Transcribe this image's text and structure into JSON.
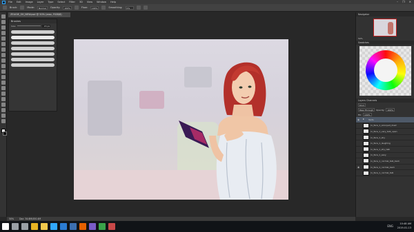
{
  "menubar": {
    "app_logo": "Ps",
    "items": [
      "File",
      "Edit",
      "Image",
      "Layer",
      "Type",
      "Select",
      "Filter",
      "3D",
      "View",
      "Window",
      "Help"
    ],
    "window_controls": [
      "–",
      "❐",
      "✕"
    ]
  },
  "options": {
    "brush_label": "Brush:",
    "mode_label": "Mode:",
    "mode_value": "Normal",
    "opacity_label": "Opacity:",
    "opacity_value": "100%",
    "flow_label": "Flow:",
    "flow_value": "100%",
    "smoothing_label": "Smoothing:",
    "smoothing_value": "0%"
  },
  "document": {
    "tab_title": "ZEAGIE_SH_NEW.psd @ 50% (aroc, RGB/8)"
  },
  "brushes_panel": {
    "title": "Brushes",
    "size_label": "Size:",
    "size_value": "15 px",
    "stroke_count": 7
  },
  "navigator": {
    "tab": "Navigator",
    "zoom": "50%"
  },
  "swatches": {
    "tab": "Swatches"
  },
  "layers_panel": {
    "tabs": "Layers  Channels",
    "kind_label": "Kind",
    "blend_mode": "Pass Through",
    "opacity_label": "Opacity:",
    "opacity_value": "100%",
    "fill_label": "Fill:",
    "fill_value": "100%",
    "layers": [
      {
        "name": "Texts",
        "type": "folder",
        "visible": true,
        "selected": true
      },
      {
        "name": "ro_face_1_annoyed_down",
        "type": "layer",
        "visible": false,
        "selected": false
      },
      {
        "name": "ro_face_1_very_talk_open",
        "type": "layer",
        "visible": false,
        "selected": false
      },
      {
        "name": "ro_face_1_shy",
        "type": "layer",
        "visible": false,
        "selected": false
      },
      {
        "name": "ro_face_1_laughing",
        "type": "layer",
        "visible": false,
        "selected": false
      },
      {
        "name": "ro_face_1_shy_talk",
        "type": "layer",
        "visible": false,
        "selected": false
      },
      {
        "name": "ro_face_1_sexy",
        "type": "layer",
        "visible": false,
        "selected": false
      },
      {
        "name": "ro_face_1_normal_talk_back",
        "type": "layer",
        "visible": false,
        "selected": false
      },
      {
        "name": "ro_face_1_normal_back",
        "type": "layer",
        "visible": true,
        "selected": false
      },
      {
        "name": "ro_face_1_normal_talk",
        "type": "layer",
        "visible": false,
        "selected": false
      }
    ]
  },
  "statusbar": {
    "zoom": "50%",
    "doc_info": "Doc: 34.6M/450.4M"
  },
  "taskbar": {
    "icons": [
      {
        "name": "windows-start-icon",
        "color": "#ffffff"
      },
      {
        "name": "search-icon",
        "color": "#9aa0a6"
      },
      {
        "name": "task-view-icon",
        "color": "#9aa0a6"
      },
      {
        "name": "chrome-icon",
        "color": "#e8b423"
      },
      {
        "name": "file-explorer-icon",
        "color": "#f2c94c"
      },
      {
        "name": "photoshop-icon",
        "color": "#31a8ff"
      },
      {
        "name": "store-icon",
        "color": "#2b7cd3"
      },
      {
        "name": "media-icon",
        "color": "#3c6fb0"
      },
      {
        "name": "firefox-icon",
        "color": "#e66000"
      },
      {
        "name": "app-icon",
        "color": "#7a5cc8"
      },
      {
        "name": "app-icon-2",
        "color": "#3aa24a"
      },
      {
        "name": "app-icon-3",
        "color": "#c84848"
      }
    ],
    "language": "ENG",
    "time": "10:48 AM",
    "date": "2019-01-13"
  }
}
